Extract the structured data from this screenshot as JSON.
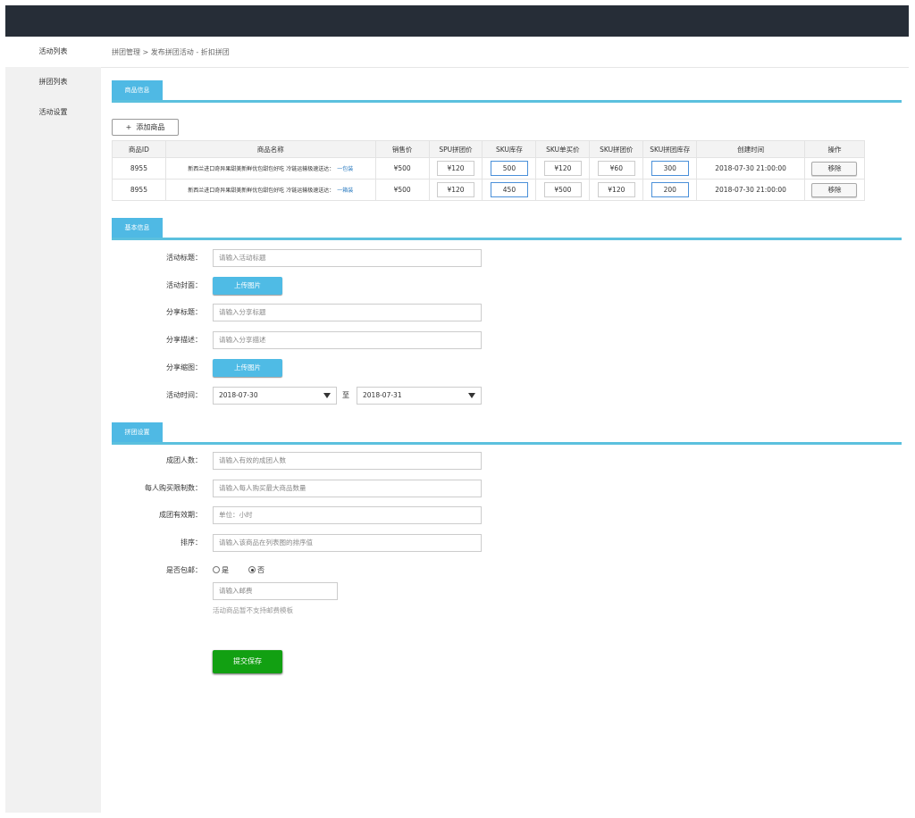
{
  "sidebar": {
    "items": [
      {
        "label": "活动列表",
        "active": true
      },
      {
        "label": "拼团列表",
        "active": false
      },
      {
        "label": "活动设置",
        "active": false
      }
    ]
  },
  "breadcrumb": "拼团管理 > 发布拼团活动 - 折扣拼团",
  "product_section": {
    "title": "商品信息",
    "add_button": "添加商品",
    "add_icon": "+",
    "columns": [
      "商品ID",
      "商品名称",
      "销售价",
      "SPU拼团价",
      "SKU库存",
      "SKU单买价",
      "SKU拼团价",
      "SKU拼团库存",
      "创建时间",
      "操作"
    ],
    "rows": [
      {
        "id": "8955",
        "name": "新西兰进口奇异果甜美新鲜优包甜包好吃 冷链运输极速送达：",
        "spec": "一包装",
        "price": "¥500",
        "spu_price": "¥120",
        "sku_stock": "500",
        "sku_single": "¥120",
        "sku_group": "¥60",
        "sku_group_stock": "300",
        "created": "2018-07-30 21:00:00",
        "action": "移除"
      },
      {
        "id": "8955",
        "name": "新西兰进口奇异果甜美新鲜优包甜包好吃 冷链运输极速送达：",
        "spec": "一箱装",
        "price": "¥500",
        "spu_price": "¥120",
        "sku_stock": "450",
        "sku_single": "¥500",
        "sku_group": "¥120",
        "sku_group_stock": "200",
        "created": "2018-07-30 21:00:00",
        "action": "移除"
      }
    ]
  },
  "basic_section": {
    "title": "基本信息",
    "activity_title_label": "活动标题：",
    "activity_title_placeholder": "请输入活动标题",
    "cover_label": "活动封面：",
    "cover_button": "上传图片",
    "share_title_label": "分享标题：",
    "share_title_placeholder": "请输入分享标题",
    "share_desc_label": "分享描述：",
    "share_desc_placeholder": "请输入分享描述",
    "share_image_label": "分享缩图：",
    "share_image_button": "上传图片",
    "time_label": "活动时间：",
    "start_date": "2018-07-30",
    "to_label": "至",
    "end_date": "2018-07-31"
  },
  "group_section": {
    "title": "拼团设置",
    "size_label": "成团人数：",
    "size_placeholder": "请输入有效的成团人数",
    "limit_label": "每人购买限制数：",
    "limit_placeholder": "请输入每人购买最大商品数量",
    "valid_label": "成团有效期：",
    "valid_placeholder": "单位：小时",
    "sort_label": "排序：",
    "sort_placeholder": "请输入该商品在列表图的排序值",
    "shipping_label": "是否包邮：",
    "yes_label": "是",
    "no_label": "否",
    "shipping_selected": "否",
    "fee_placeholder": "请输入邮费",
    "hint": "活动商品暂不支持邮费模板",
    "submit": "提交保存"
  },
  "colors": {
    "topbar": "#262d37",
    "accent": "#4fb9e4",
    "submit": "#12a012"
  }
}
